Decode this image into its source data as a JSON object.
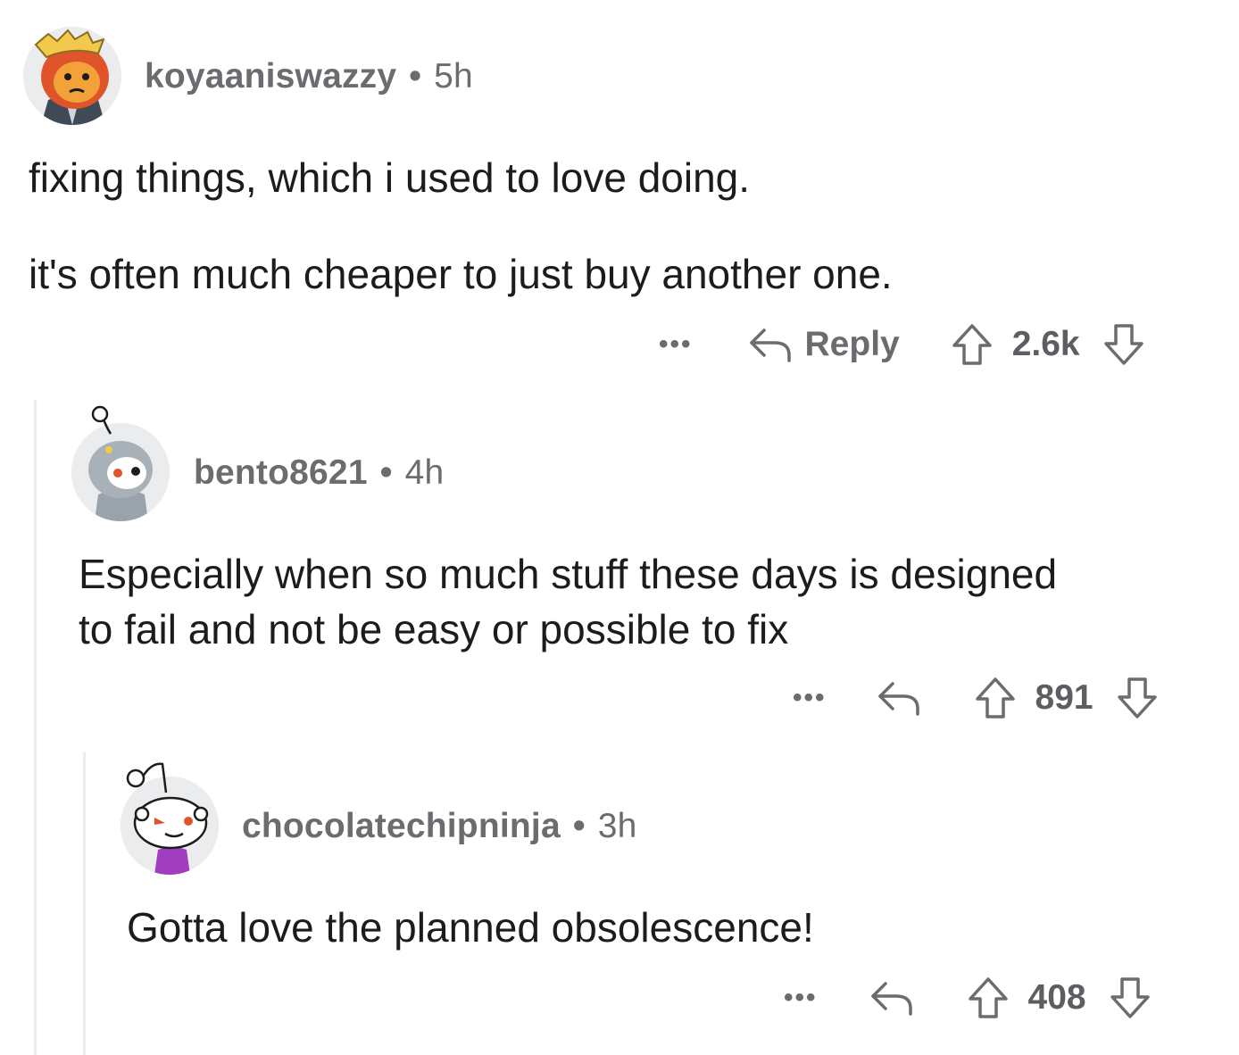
{
  "comments": [
    {
      "author": "koyaaniswazzy",
      "separator": "•",
      "time": "5h",
      "paragraphs": [
        "fixing things, which i used to love doing.",
        "it's often much cheaper to just buy another one."
      ],
      "more": "•••",
      "reply_label": "Reply",
      "score": "2.6k",
      "avatar_icon": "snoo-avatar-orange-hood"
    },
    {
      "author": "bento8621",
      "separator": "•",
      "time": "4h",
      "paragraphs": [
        "Especially when so much stuff these days is designed",
        "to fail and not be easy or possible to fix"
      ],
      "more": "•••",
      "score": "891",
      "avatar_icon": "snoo-avatar-gray-hood"
    },
    {
      "author": "chocolatechipninja",
      "separator": "•",
      "time": "3h",
      "paragraphs": [
        "Gotta love the planned obsolescence!"
      ],
      "more": "•••",
      "score": "408",
      "avatar_icon": "snoo-avatar-purple-shirt"
    }
  ],
  "icons": {
    "reply": "reply-arrow-icon",
    "upvote": "upvote-arrow-icon",
    "downvote": "downvote-arrow-icon",
    "more": "more-options-icon"
  },
  "colors": {
    "meta_text": "#6a6c6f",
    "body_text": "#1c1c1c",
    "thread_line": "#ededed"
  }
}
